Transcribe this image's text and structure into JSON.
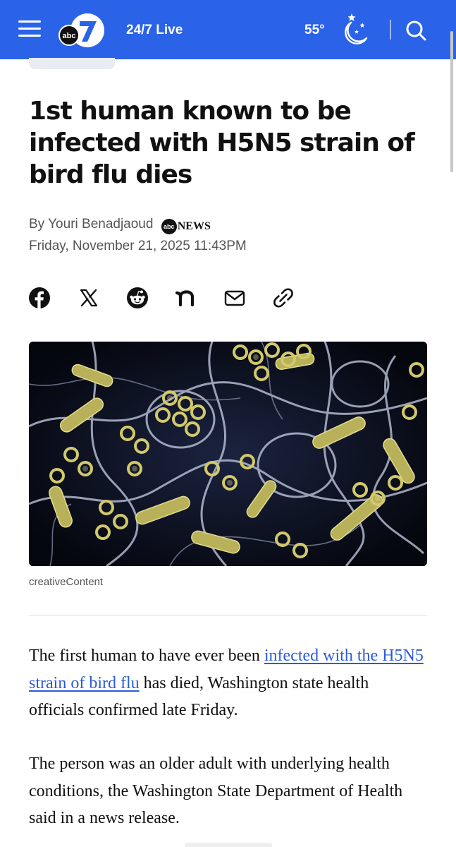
{
  "header": {
    "live_label": "24/7 Live",
    "temperature": "55°",
    "logo_badge": "abc",
    "logo_number": "7",
    "weather_icon": "moon-stars-icon",
    "background_color": "#2a63e8"
  },
  "article": {
    "headline": "1st human known to be infected with H5N5 strain of bird flu dies",
    "byline_prefix": "By",
    "author": "Youri Benadjaoud",
    "outlet_badge": "abc",
    "outlet_name": "NEWS",
    "date": "Friday, November 21, 2025 11:43PM",
    "share_icons": [
      "facebook-icon",
      "x-icon",
      "reddit-icon",
      "nextdoor-icon",
      "email-icon",
      "copy-link-icon"
    ],
    "image_caption": "creativeContent",
    "paragraph_1": {
      "before": "The first human to have ever been ",
      "link": "infected with the H5N5 strain of bird flu",
      "after": " has died, Washington state health officials confirmed late Friday."
    },
    "paragraph_2": "The person was an older adult with underlying health conditions, the Washington State Department of Health said in a news release.",
    "link_color": "#2a5bd7"
  }
}
